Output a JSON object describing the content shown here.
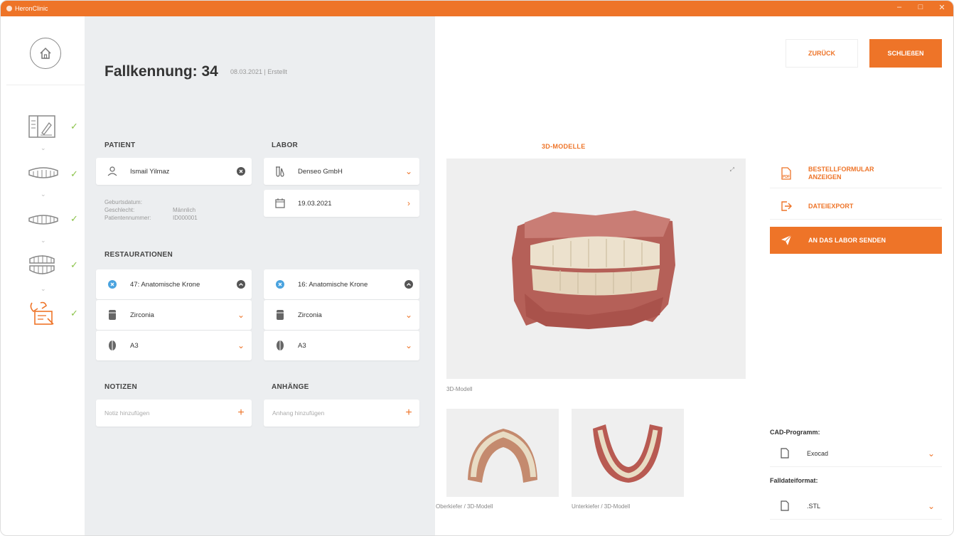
{
  "window": {
    "title": "HeronClinic",
    "minimize": "–",
    "maximize": "□",
    "close": "✕"
  },
  "nav": {
    "chevron": "⌄",
    "check": "✓"
  },
  "case": {
    "title": "Fallkennung: 34",
    "subtitle": "08.03.2021 | Erstellt"
  },
  "patient": {
    "section": "PATIENT",
    "name": "Ismail Yilmaz",
    "birth_label": "Geburtsdatum:",
    "gender_label": "Geschlecht:",
    "gender_value": "Männlich",
    "number_label": "Patientennummer:",
    "number_value": "ID000001"
  },
  "labor": {
    "section": "LABOR",
    "name": "Denseo GmbH",
    "date": "19.03.2021"
  },
  "restorations": {
    "section": "RESTAURATIONEN",
    "items": [
      {
        "label": "47: Anatomische Krone",
        "material": "Zirconia",
        "shade": "A3"
      },
      {
        "label": "16: Anatomische Krone",
        "material": "Zirconia",
        "shade": "A3"
      }
    ]
  },
  "notes": {
    "section": "NOTIZEN",
    "placeholder": "Notiz hinzufügen"
  },
  "attachments": {
    "section": "ANHÄNGE",
    "placeholder": "Anhang hinzufügen"
  },
  "models": {
    "heading": "3D-MODELLE",
    "main_caption": "3D-Modell",
    "upper_caption": "Oberkiefer / 3D-Modell",
    "lower_caption": "Unterkiefer / 3D-Modell"
  },
  "actions": {
    "back": "ZURÜCK",
    "close": "SCHLIEßEN",
    "order_form_line1": "BESTELLFORMULAR",
    "order_form_line2": "ANZEIGEN",
    "export": "DATEIEXPORT",
    "send": "AN DAS LABOR SENDEN"
  },
  "cad": {
    "label": "CAD-Programm:",
    "value": "Exocad",
    "format_label": "Falldateiformat:",
    "format_value": ".STL"
  },
  "icons": {
    "pdf_text": "PDF",
    "plus": "+",
    "chevron_down": "⌄",
    "chevron_right": "›",
    "accent": "#ee7428",
    "check_color": "#8bc34a"
  }
}
